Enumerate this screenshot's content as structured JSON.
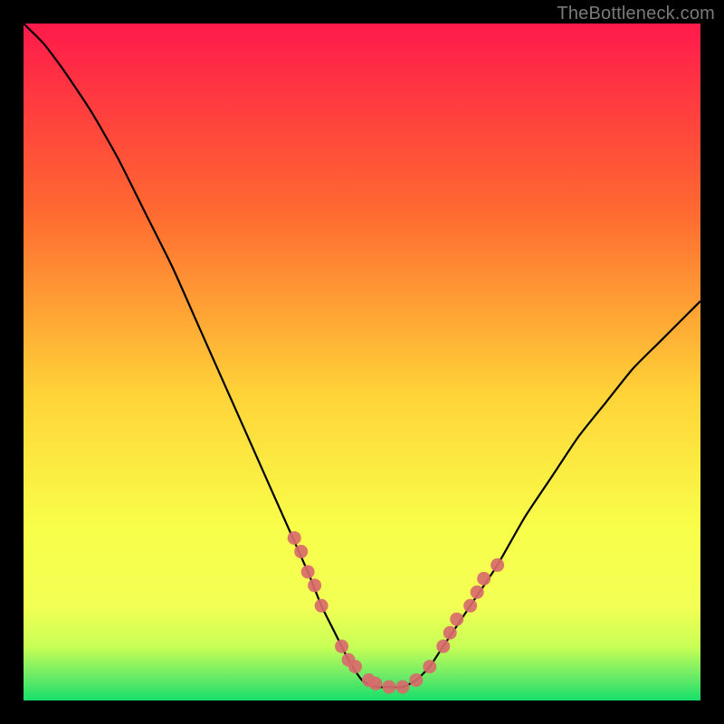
{
  "watermark": "TheBottleneck.com",
  "colors": {
    "background": "#000000",
    "gradient_top": "#ff1a4b",
    "gradient_upper_mid": "#ff8a2a",
    "gradient_mid": "#ffe438",
    "gradient_lower_mid": "#f3ff55",
    "gradient_bottom": "#16e06a",
    "curve": "#000000",
    "marker": "#d86b6b"
  },
  "chart_data": {
    "type": "line",
    "title": "",
    "xlabel": "",
    "ylabel": "",
    "xlim": [
      0,
      100
    ],
    "ylim": [
      0,
      100
    ],
    "series": [
      {
        "name": "bottleneck-curve",
        "x": [
          0,
          3,
          6,
          10,
          14,
          18,
          22,
          26,
          30,
          34,
          38,
          42,
          44,
          46,
          48,
          50,
          52,
          54,
          56,
          58,
          60,
          62,
          66,
          70,
          74,
          78,
          82,
          86,
          90,
          94,
          98,
          100
        ],
        "y": [
          100,
          97,
          93,
          87,
          80,
          72,
          64,
          55,
          46,
          37,
          28,
          19,
          14,
          10,
          6,
          3,
          2,
          2,
          2,
          3,
          5,
          8,
          14,
          20,
          27,
          33,
          39,
          44,
          49,
          53,
          57,
          59
        ]
      }
    ],
    "markers": {
      "name": "highlighted-points",
      "x": [
        40,
        41,
        42,
        43,
        44,
        47,
        48,
        49,
        51,
        52,
        54,
        56,
        58,
        60,
        62,
        63,
        64,
        66,
        67,
        68,
        70
      ],
      "y": [
        24,
        22,
        19,
        17,
        14,
        8,
        6,
        5,
        3,
        2.5,
        2,
        2,
        3,
        5,
        8,
        10,
        12,
        14,
        16,
        18,
        20
      ]
    },
    "gradient_stops": [
      {
        "offset": 0.0,
        "color": "#ff1a4b"
      },
      {
        "offset": 0.28,
        "color": "#ff6a30"
      },
      {
        "offset": 0.55,
        "color": "#ffd438"
      },
      {
        "offset": 0.75,
        "color": "#f8ff4a"
      },
      {
        "offset": 0.86,
        "color": "#f3ff55"
      },
      {
        "offset": 0.92,
        "color": "#c9ff55"
      },
      {
        "offset": 0.97,
        "color": "#5fe868"
      },
      {
        "offset": 1.0,
        "color": "#16e06a"
      }
    ]
  }
}
